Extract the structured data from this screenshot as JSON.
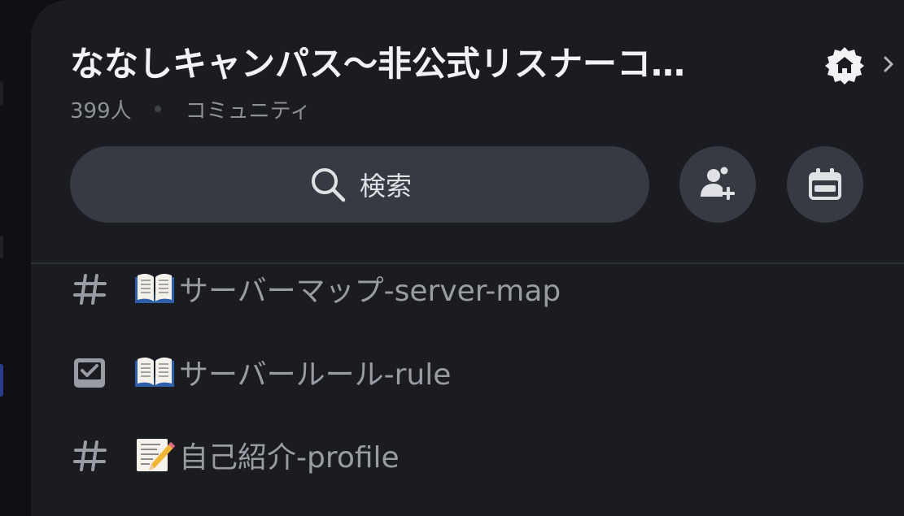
{
  "server": {
    "name": "ななしキャンパス〜非公式リスナーコ…",
    "member_count": "399人",
    "type_label": "コミュニティ",
    "badge_icon": "community-home-badge-icon"
  },
  "search": {
    "label": "検索",
    "icon": "search-icon"
  },
  "actions": {
    "invite_icon": "add-member-icon",
    "events_icon": "calendar-icon"
  },
  "channels": [
    {
      "type": "text",
      "icon": "hash-icon",
      "emoji": "open-book-emoji",
      "name": "サーバーマップ-server-map"
    },
    {
      "type": "rules",
      "icon": "rules-checkbox-icon",
      "emoji": "open-book-emoji",
      "name": "サーバールール-rule"
    },
    {
      "type": "text",
      "icon": "hash-icon",
      "emoji": "memo-pencil-emoji",
      "name": "自己紹介-profile"
    }
  ],
  "colors": {
    "background": "#1b1c22",
    "button": "#373a43",
    "text_primary": "#f2f3f5",
    "text_muted": "#8e9097",
    "channel_text": "#9a9ca3"
  }
}
